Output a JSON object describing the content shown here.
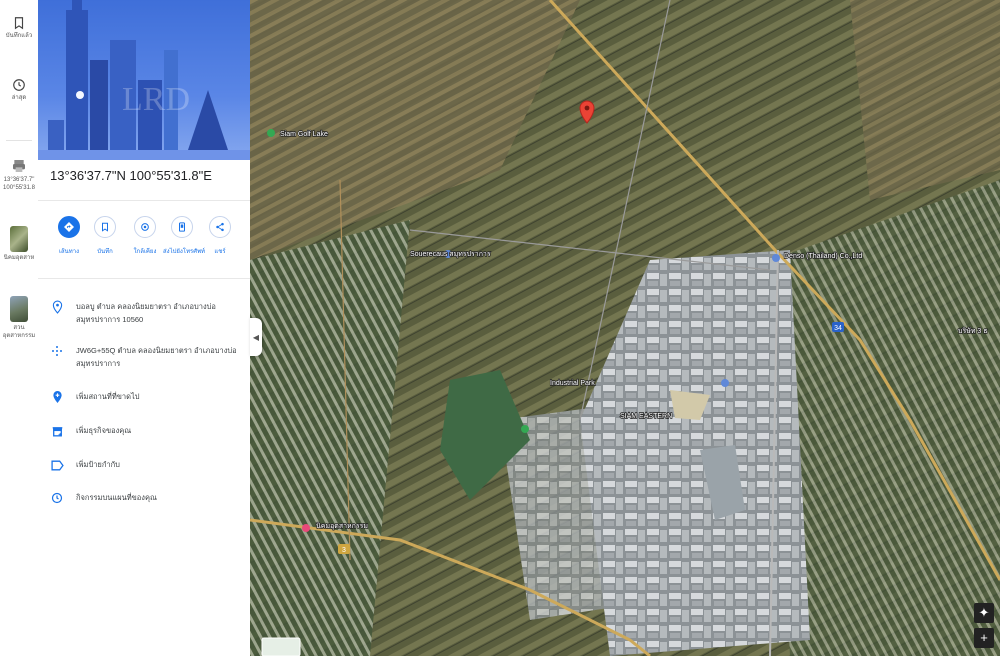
{
  "rail": {
    "saved_label": "บันทึกแล้ว",
    "recent_label": "ล่าสุด",
    "recent_item_label": "13°36'37.7\"\n100°55'31.8",
    "recent_item2_label": "นิคมอุตสาห",
    "recent_item3_label": "สวน อุตสาหกรรม"
  },
  "place": {
    "coordinates": "13°36'37.7\"N 100°55'31.8\"E",
    "hero_watermark": "LRD"
  },
  "actions": [
    {
      "label": "เส้นทาง"
    },
    {
      "label": "บันทึก"
    },
    {
      "label": "ใกล้เคียง"
    },
    {
      "label": "ส่งไปยังโทรศัพท์"
    },
    {
      "label": "แชร์"
    }
  ],
  "info": {
    "address": "บอลบู ตำบล คลองนิยมยาตรา อำเภอบางบ่อ สมุทรปราการ 10560",
    "plus_code": "JW6G+55Q ตำบล คลองนิยมยาตรา อำเภอบางบ่อ สมุทรปราการ",
    "add_missing_place": "เพิ่มสถานที่ที่ขาดไป",
    "add_business": "เพิ่มธุรกิจของคุณ",
    "add_label": "เพิ่มป้ายกำกับ",
    "map_activity": "กิจกรรมบนแผนที่ของคุณ"
  },
  "map": {
    "pois": [
      {
        "name": "Siam Golf Lake"
      },
      {
        "name": "Denso (Thailand) Co.,Ltd"
      },
      {
        "name": "Souerecaus สมุทรปราการ"
      },
      {
        "name": "บริษัท 3 ธ"
      },
      {
        "name": "SIAM EASTERN"
      },
      {
        "name": "Industrial Park"
      },
      {
        "name": "นิคมอุตสาหกรรม"
      }
    ],
    "road_badges": [
      "34",
      "3"
    ]
  }
}
